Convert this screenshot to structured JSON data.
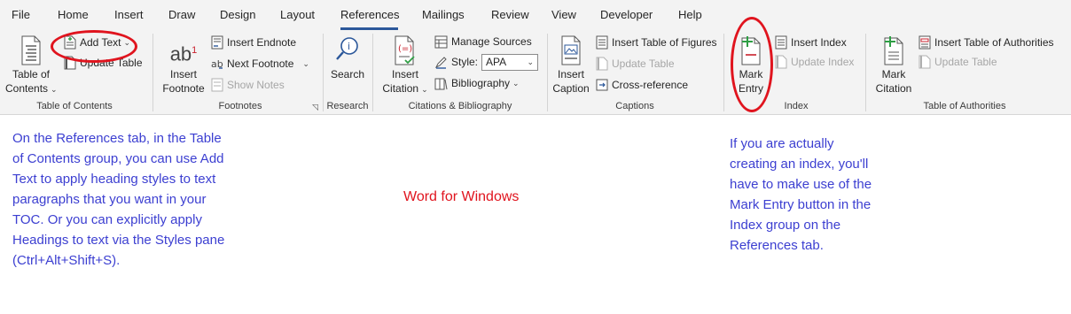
{
  "tabs": [
    "File",
    "Home",
    "Insert",
    "Draw",
    "Design",
    "Layout",
    "References",
    "Mailings",
    "Review",
    "View",
    "Developer",
    "Help"
  ],
  "active_tab": "References",
  "groups": {
    "toc": {
      "label": "Table of Contents",
      "toc_line1": "Table of",
      "toc_line2": "Contents",
      "add_text": "Add Text",
      "update_table": "Update Table"
    },
    "footnotes": {
      "label": "Footnotes",
      "insert_footnote_line1": "Insert",
      "insert_footnote_line2": "Footnote",
      "ab_glyph": "ab",
      "footnote_superscript": "1",
      "insert_endnote": "Insert Endnote",
      "next_footnote": "Next Footnote",
      "show_notes": "Show Notes"
    },
    "research": {
      "label": "Research",
      "search": "Search"
    },
    "citations": {
      "label": "Citations & Bibliography",
      "insert_citation_line1": "Insert",
      "insert_citation_line2": "Citation",
      "manage_sources": "Manage Sources",
      "style_label": "Style:",
      "style_value": "APA",
      "bibliography": "Bibliography"
    },
    "captions": {
      "label": "Captions",
      "insert_caption_line1": "Insert",
      "insert_caption_line2": "Caption",
      "insert_table_of_figures": "Insert Table of Figures",
      "update_table": "Update Table",
      "cross_reference": "Cross-reference"
    },
    "index": {
      "label": "Index",
      "mark_entry_line1": "Mark",
      "mark_entry_line2": "Entry",
      "insert_index": "Insert Index",
      "update_index": "Update Index"
    },
    "authorities": {
      "label": "Table of Authorities",
      "mark_citation_line1": "Mark",
      "mark_citation_line2": "Citation",
      "insert_table_of_authorities": "Insert Table of Authorities",
      "update_table": "Update Table"
    }
  },
  "notes": {
    "left": [
      "On the References tab, in the Table",
      "of Contents group, you can use Add",
      "Text to apply heading styles to text",
      "paragraphs that you want in your",
      "TOC. Or you can explicitly apply",
      "Headings to text via the Styles pane",
      "(Ctrl+Alt+Shift+S)."
    ],
    "center": "Word for Windows",
    "right": [
      "If you are actually",
      "creating an index, you'll",
      "have to make use of the",
      "Mark Entry button in the",
      "Index group on the",
      "References tab."
    ]
  },
  "colors": {
    "accent": "#2b579a",
    "annotation_red": "#e0141e",
    "note_blue": "#3c3fd1",
    "icon_green": "#2e9e44",
    "icon_red": "#c8202c"
  }
}
